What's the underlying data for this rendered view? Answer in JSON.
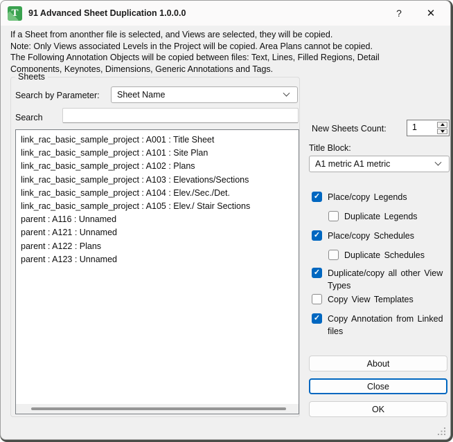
{
  "window": {
    "title": "91 Advanced Sheet Duplication 1.0.0.0",
    "help_glyph": "?",
    "close_glyph": "✕",
    "app_icon_letter": "T"
  },
  "info": {
    "lines": [
      "If a Sheet from anonther file is selected, and Views are selected, they will be copied.",
      "Note: Only Views associated Levels in the Project will be copied. Area Plans cannot be copied.",
      "The Following Annotation Objects will be copied between files: Text, Lines, Filled Regions, Detail",
      "Components, Keynotes, Dimensions, Generic Annotations and Tags."
    ]
  },
  "sheets_group": {
    "label": "Sheets",
    "search_by_parameter_label": "Search by Parameter:",
    "parameter_value": "Sheet Name",
    "search_label": "Search",
    "search_value": "",
    "items": [
      "link_rac_basic_sample_project : A001 : Title Sheet",
      "link_rac_basic_sample_project : A101 : Site Plan",
      "link_rac_basic_sample_project : A102 : Plans",
      "link_rac_basic_sample_project : A103 : Elevations/Sections",
      "link_rac_basic_sample_project : A104 : Elev./Sec./Det.",
      "link_rac_basic_sample_project : A105 : Elev./ Stair Sections",
      "parent : A116 : Unnamed",
      "parent : A121 : Unnamed",
      "parent : A122 : Plans",
      "parent : A123 : Unnamed"
    ]
  },
  "options": {
    "new_sheets_count_label": "New Sheets Count:",
    "new_sheets_count_value": "1",
    "title_block_label": "Title Block:",
    "title_block_value": "A1 metric A1 metric",
    "checkboxes": [
      {
        "label": "Place/copy Legends",
        "checked": true,
        "indent": false
      },
      {
        "label": "Duplicate Legends",
        "checked": false,
        "indent": true
      },
      {
        "label": "Place/copy Schedules",
        "checked": true,
        "indent": false
      },
      {
        "label": "Duplicate Schedules",
        "checked": false,
        "indent": true
      },
      {
        "label": "Duplicate/copy all other View Types",
        "checked": true,
        "indent": false
      },
      {
        "label": "Copy View Templates",
        "checked": false,
        "indent": false
      },
      {
        "label": "Copy Annotation from Linked files",
        "checked": true,
        "indent": false
      }
    ]
  },
  "buttons": {
    "about": "About",
    "close": "Close",
    "ok": "OK"
  },
  "colors": {
    "accent": "#0067c0",
    "window_bg": "#f0f0f0",
    "titlebar_bg": "#fbfafa",
    "icon_green": "#3aa24f",
    "list_border": "#7a7e83"
  }
}
